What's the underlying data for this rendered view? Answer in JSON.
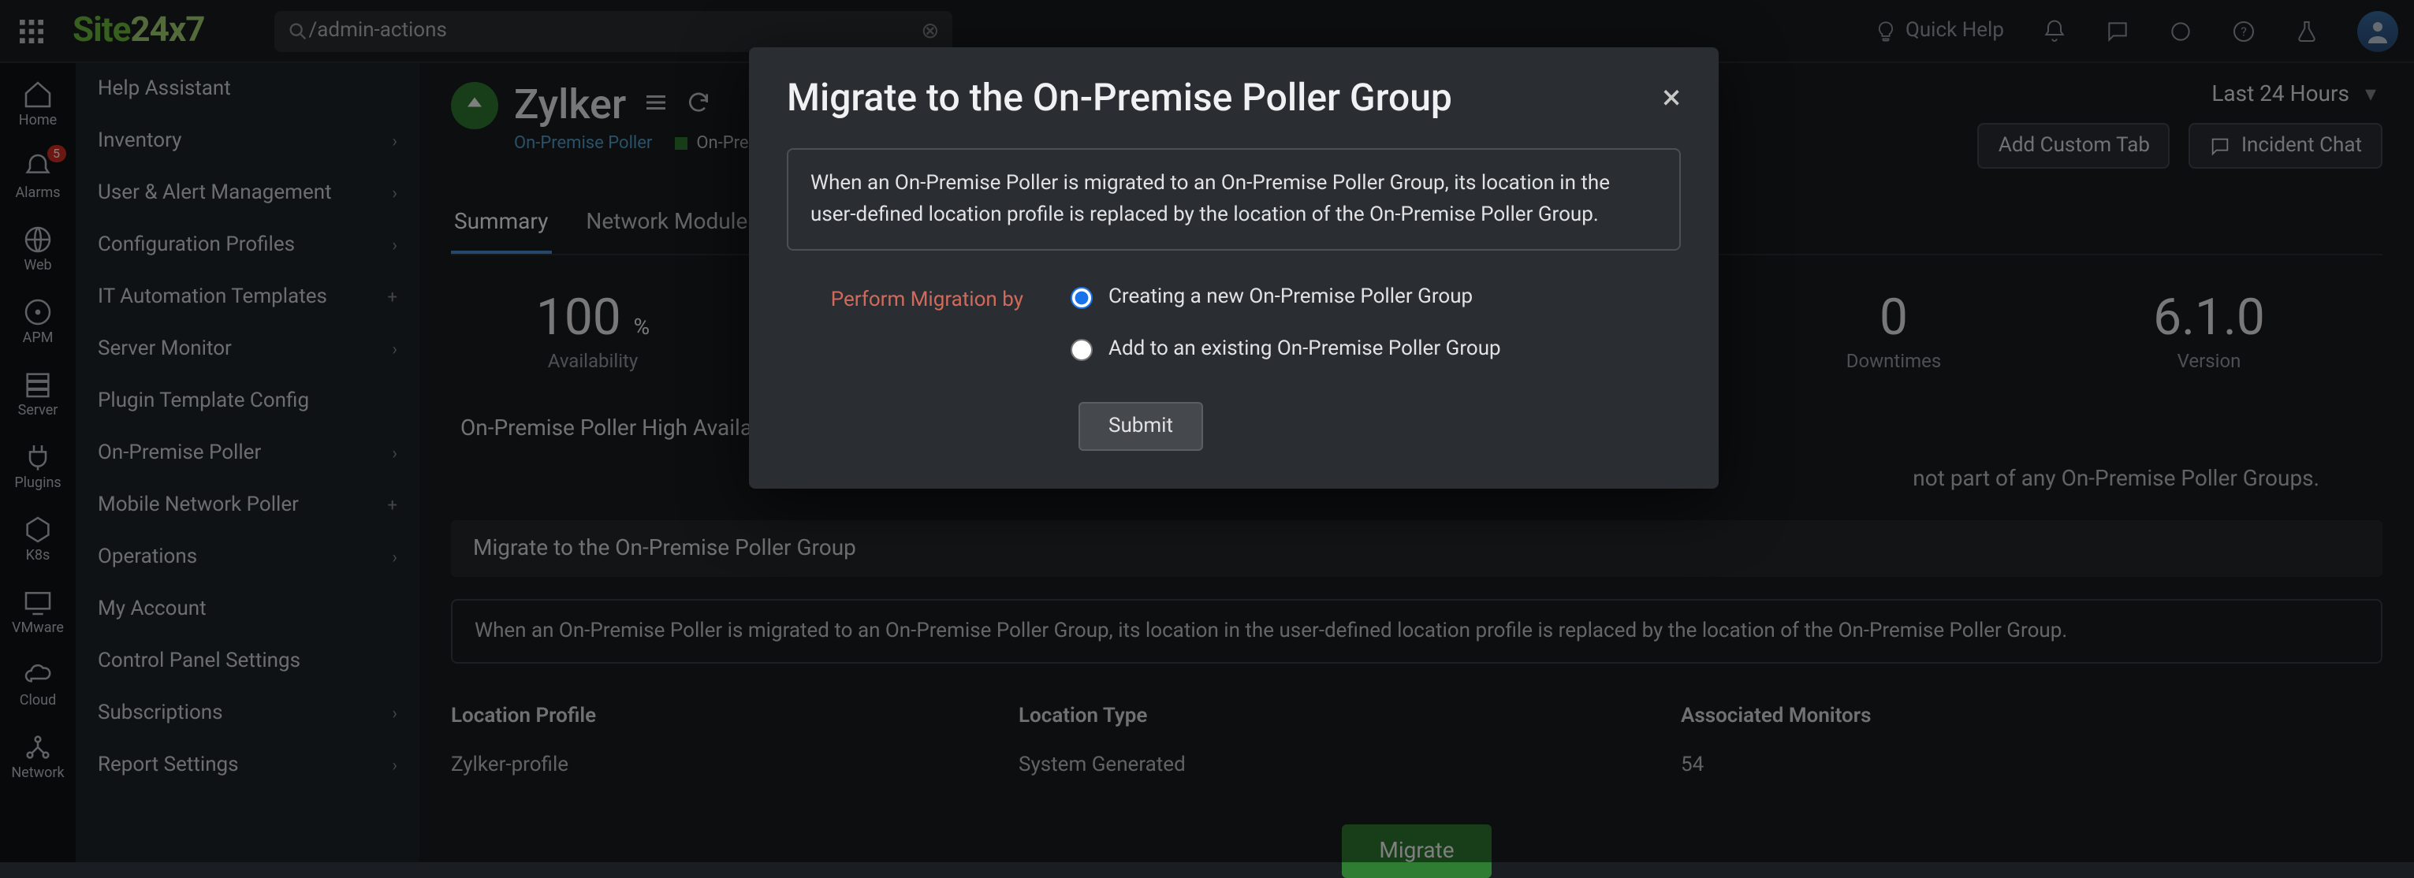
{
  "search": {
    "value": "/admin-actions"
  },
  "top": {
    "quick_help": "Quick Help"
  },
  "rail": [
    {
      "label": "Home"
    },
    {
      "label": "Alarms",
      "badge": "5"
    },
    {
      "label": "Web"
    },
    {
      "label": "APM"
    },
    {
      "label": "Server"
    },
    {
      "label": "Plugins"
    },
    {
      "label": "K8s"
    },
    {
      "label": "VMware"
    },
    {
      "label": "Cloud"
    },
    {
      "label": "Network"
    }
  ],
  "nav": [
    {
      "label": "Help Assistant",
      "expand": false
    },
    {
      "label": "Inventory",
      "expand": true
    },
    {
      "label": "User & Alert Management",
      "expand": true
    },
    {
      "label": "Configuration Profiles",
      "expand": true
    },
    {
      "label": "IT Automation Templates",
      "expand": "plus"
    },
    {
      "label": "Server Monitor",
      "expand": true
    },
    {
      "label": "Plugin Template Config",
      "expand": false
    },
    {
      "label": "On-Premise Poller",
      "expand": true
    },
    {
      "label": "Mobile Network Poller",
      "expand": "plus"
    },
    {
      "label": "Operations",
      "expand": true
    },
    {
      "label": "My Account",
      "expand": false
    },
    {
      "label": "Control Panel Settings",
      "expand": false
    },
    {
      "label": "Subscriptions",
      "expand": true
    },
    {
      "label": "Report Settings",
      "expand": true
    }
  ],
  "page": {
    "title": "Zylker",
    "crumb_parent": "On-Premise Poller",
    "crumb_child": "On-Prem…",
    "time_range": "Last 24 Hours",
    "add_tab": "Add Custom Tab",
    "incident_chat": "Incident Chat"
  },
  "tabs": [
    "Summary",
    "Network Module"
  ],
  "stats": [
    {
      "val": "100",
      "suffix": "%",
      "label": "Availability"
    },
    {
      "val": "0",
      "suffix": "",
      "label": "Downtimes"
    },
    {
      "val": "6.1.0",
      "suffix": "",
      "label": "Version"
    }
  ],
  "ha": {
    "title": "On-Premise Poller High Availability",
    "text": "not part of any On-Premise Poller Groups."
  },
  "migrate_section": {
    "title": "Migrate to the On-Premise Poller Group",
    "info": "When an On-Premise Poller is migrated to an On-Premise Poller Group, its location in the user-defined location profile is replaced by the location of the On-Premise Poller Group.",
    "cols": [
      "Location Profile",
      "Location Type",
      "Associated Monitors"
    ],
    "row": [
      "Zylker-profile",
      "System Generated",
      "54"
    ],
    "button": "Migrate"
  },
  "modal": {
    "title": "Migrate to the On-Premise Poller Group",
    "info": "When an On-Premise Poller is migrated to an On-Premise Poller Group, its location in the user-defined location profile is replaced by the location of the On-Premise Poller Group.",
    "form_label": "Perform Migration by",
    "opt1": "Creating a new On-Premise Poller Group",
    "opt2": "Add to an existing On-Premise Poller Group",
    "submit": "Submit"
  }
}
